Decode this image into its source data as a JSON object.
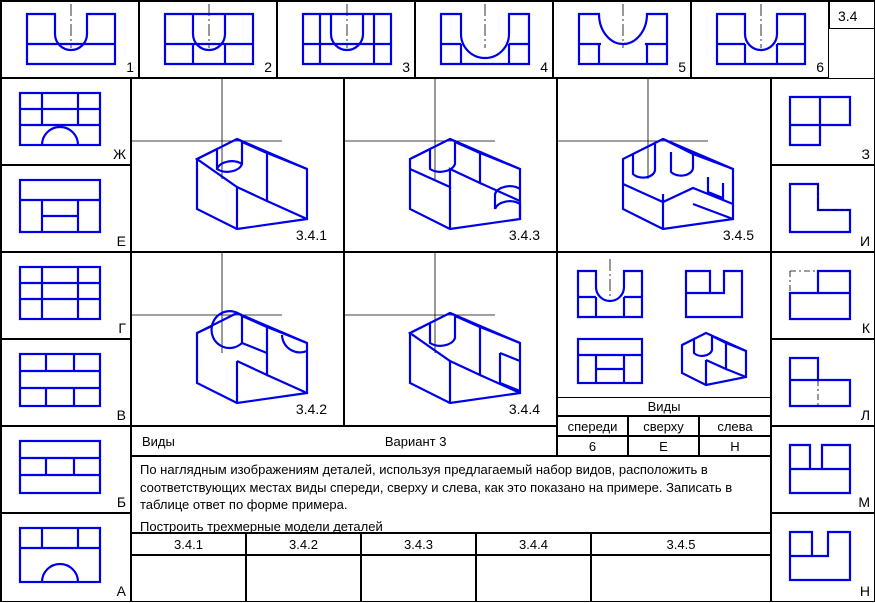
{
  "page_number": "3.4",
  "top_row": [
    {
      "label": "1"
    },
    {
      "label": "2"
    },
    {
      "label": "3"
    },
    {
      "label": "4"
    },
    {
      "label": "5"
    },
    {
      "label": "6"
    }
  ],
  "left_col": [
    {
      "label": "Ж"
    },
    {
      "label": "Е"
    },
    {
      "label": "Г"
    },
    {
      "label": "В"
    },
    {
      "label": "Б"
    },
    {
      "label": "А"
    }
  ],
  "right_col": [
    {
      "label": "З"
    },
    {
      "label": "И"
    },
    {
      "label": "К"
    },
    {
      "label": "Л"
    },
    {
      "label": "М"
    },
    {
      "label": "Н"
    }
  ],
  "iso_parts": [
    {
      "label": "3.4.1"
    },
    {
      "label": "3.4.2"
    },
    {
      "label": "3.4.3"
    },
    {
      "label": "3.4.4"
    },
    {
      "label": "3.4.5"
    }
  ],
  "example": {
    "title": "Виды",
    "headers": [
      "спереди",
      "сверху",
      "слева"
    ],
    "values": [
      "6",
      "Е",
      "Н"
    ]
  },
  "title_row": {
    "left": "Виды",
    "center": "Вариант 3"
  },
  "instructions": "По наглядным изображениям деталей, используя предлагаемый набор видов, расположить в соответствующих местах виды спереди, сверху и слева, как это показано на примере. Записать в таблице ответ по форме  примера.",
  "instruction_line2": "Построить трехмерные модели деталей",
  "answer_cells": [
    "3.4.1",
    "3.4.2",
    "3.4.3",
    "3.4.4",
    "3.4.5"
  ]
}
